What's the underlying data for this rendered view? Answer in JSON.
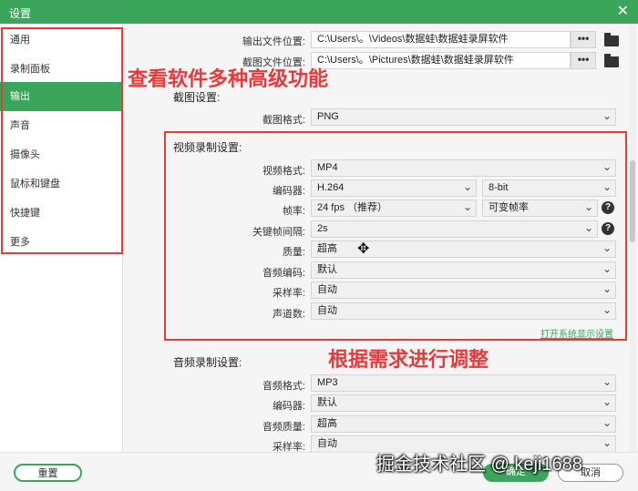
{
  "window": {
    "title": "设置",
    "close": "✕"
  },
  "sidebar": {
    "items": [
      {
        "label": "通用"
      },
      {
        "label": "录制面板"
      },
      {
        "label": "输出"
      },
      {
        "label": "声音"
      },
      {
        "label": "摄像头"
      },
      {
        "label": "鼠标和键盘"
      },
      {
        "label": "快捷键"
      },
      {
        "label": "更多"
      }
    ],
    "active_index": 2
  },
  "annotations": {
    "top": "查看软件多种高级功能",
    "middle": "根据需求进行调整"
  },
  "output": {
    "file_location_label": "输出文件位置:",
    "file_location_value": "C:\\Users\\。\\Videos\\数据蛙\\数据蛙录屏软件",
    "screenshot_location_label": "截图文件位置:",
    "screenshot_location_value": "C:\\Users\\。\\Pictures\\数据蛙\\数据蛙录屏软件",
    "dots": "•••"
  },
  "screenshot_settings": {
    "title": "截图设置:",
    "format_label": "截图格式:",
    "format_value": "PNG"
  },
  "video_settings": {
    "title": "视频录制设置:",
    "format_label": "视频格式:",
    "format_value": "MP4",
    "encoder_label": "编码器:",
    "encoder_value": "H.264",
    "bitdepth_value": "8-bit",
    "fps_label": "帧率:",
    "fps_value": "24 fps （推荐）",
    "fps_mode_value": "可变帧率",
    "keyframe_label": "关键帧间隔:",
    "keyframe_value": "2s",
    "quality_label": "质量:",
    "quality_value": "超高",
    "audio_encoder_label": "音频编码:",
    "audio_encoder_value": "默认",
    "sample_rate_label": "采样率:",
    "sample_rate_value": "自动",
    "channels_label": "声道数:",
    "channels_value": "自动",
    "display_settings_link": "打开系统显示设置",
    "help": "?"
  },
  "audio_settings": {
    "title": "音频录制设置:",
    "format_label": "音频格式:",
    "format_value": "MP3",
    "encoder_label": "编码器:",
    "encoder_value": "默认",
    "quality_label": "音频质量:",
    "quality_value": "超高",
    "sample_rate_label": "采样率:",
    "sample_rate_value": "自动"
  },
  "footer": {
    "reset": "重置",
    "ok": "确定",
    "cancel": "取消",
    "watermark": "掘金技术社区 @ keji1688"
  },
  "icons": {
    "chevron": "chevron-down-icon",
    "folder": "folder-icon",
    "help": "help-icon",
    "move_cursor": "move-cursor-icon"
  },
  "colors": {
    "accent": "#3ba55c",
    "annotation": "#e83a3a"
  }
}
